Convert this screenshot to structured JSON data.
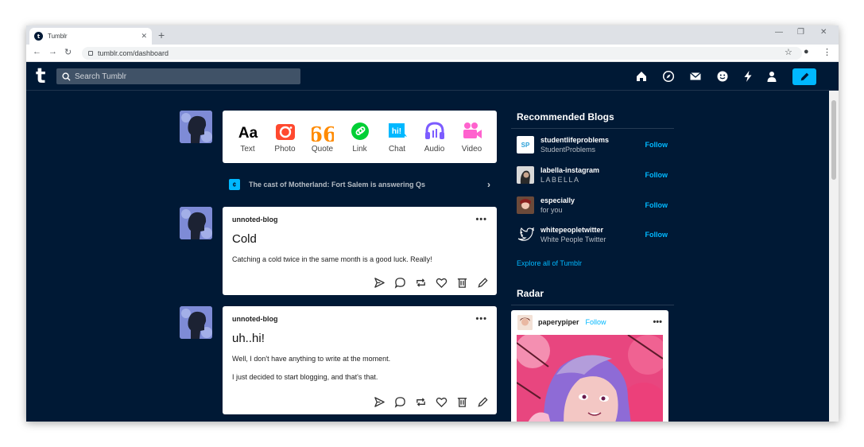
{
  "browser": {
    "tab_title": "Tumblr",
    "url": "tumblr.com/dashboard"
  },
  "header": {
    "logo": "t",
    "search_placeholder": "Search Tumblr"
  },
  "post_types": [
    {
      "label": "Text",
      "color": "#000000"
    },
    {
      "label": "Photo",
      "color": "#ff492f"
    },
    {
      "label": "Quote",
      "color": "#ff8a00"
    },
    {
      "label": "Link",
      "color": "#00cf35"
    },
    {
      "label": "Chat",
      "color": "#00b8ff"
    },
    {
      "label": "Audio",
      "color": "#7c5cff"
    },
    {
      "label": "Video",
      "color": "#ff62ce"
    }
  ],
  "type_glyphs": {
    "text": "Aa",
    "quote": "66",
    "chat": "hi!"
  },
  "banner": {
    "badge": "¢",
    "text": "The cast of Motherland: Fort Salem is answering Qs"
  },
  "posts": [
    {
      "blog": "unnoted-blog",
      "title": "Cold",
      "body": [
        "Catching a cold twice in the same month is a good luck. Really!"
      ]
    },
    {
      "blog": "unnoted-blog",
      "title": "uh..hi!",
      "body": [
        "Well, I don't have anything to write at the moment.",
        "I just decided to start blogging, and that's that."
      ]
    }
  ],
  "sidebar": {
    "recommended_title": "Recommended Blogs",
    "blogs": [
      {
        "name": "studentlifeproblems",
        "subtitle": "StudentProblems",
        "follow": "Follow",
        "avatar_text": "SP"
      },
      {
        "name": "labella-instagram",
        "subtitle": "LABELLA",
        "follow": "Follow"
      },
      {
        "name": "especially",
        "subtitle": "for you",
        "follow": "Follow"
      },
      {
        "name": "whitepeopletwitter",
        "subtitle": "White People Twitter",
        "follow": "Follow"
      }
    ],
    "explore_link": "Explore all of Tumblr",
    "radar_title": "Radar",
    "radar": {
      "blog": "paperypiper",
      "follow": "Follow"
    }
  },
  "colors": {
    "navy": "#001935",
    "accent": "#00b8ff",
    "avatar": "#7e8bd6"
  }
}
